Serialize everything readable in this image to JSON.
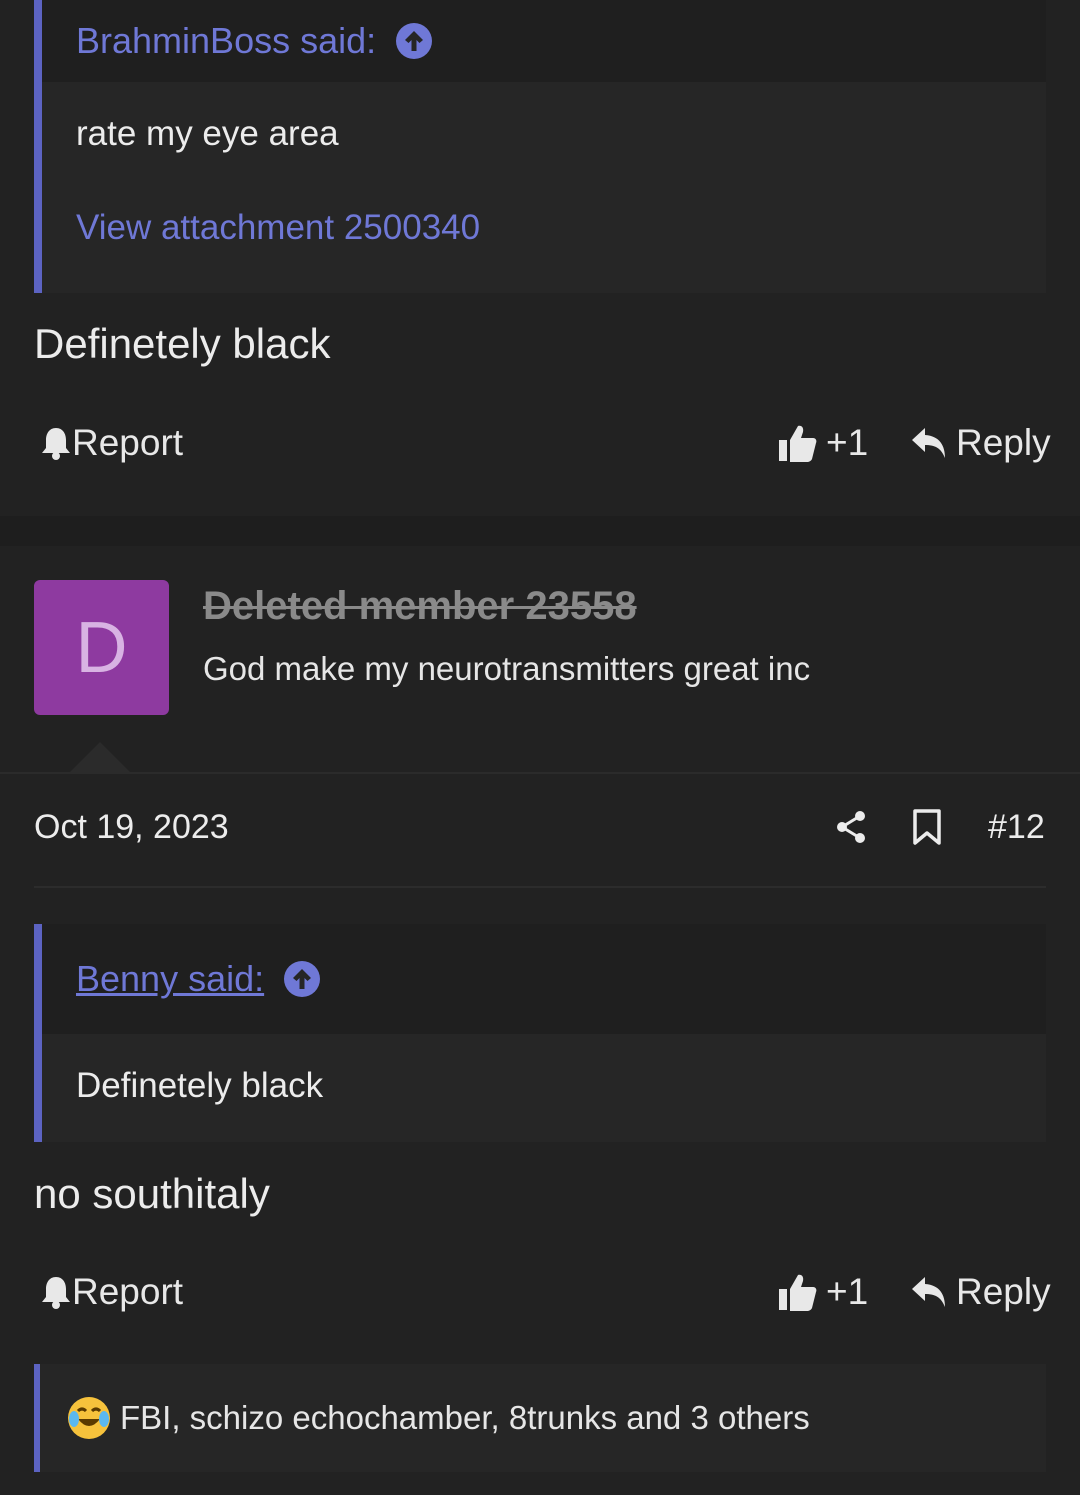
{
  "post_top": {
    "quote": {
      "author": "BrahminBoss said:",
      "text": "rate my eye area",
      "attachment_link": "View attachment 2500340"
    },
    "message": "Definetely black",
    "actions": {
      "report": "Report",
      "like": "+1",
      "reply": "Reply"
    }
  },
  "post_main": {
    "author": {
      "avatar_letter": "D",
      "username": "Deleted member 23558",
      "title": "God make my neurotransmitters great inc"
    },
    "date": "Oct 19, 2023",
    "post_number": "#12",
    "quote": {
      "author": "Benny said:",
      "text": "Definetely black"
    },
    "message": "no southitaly",
    "actions": {
      "report": "Report",
      "like": "+1",
      "reply": "Reply"
    },
    "reactions": "FBI, schizo echochamber, 8trunks and 3 others"
  },
  "colors": {
    "background": "#222222",
    "accent": "#5c63c2",
    "link": "#6f78d6",
    "avatar": "#8e3aa0"
  }
}
